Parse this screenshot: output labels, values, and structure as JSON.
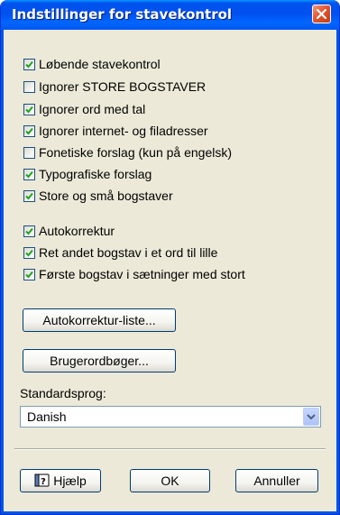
{
  "window": {
    "title": "Indstillinger for stavekontrol"
  },
  "options_group1": [
    {
      "label": "Løbende stavekontrol",
      "checked": true
    },
    {
      "label": "Ignorer STORE BOGSTAVER",
      "checked": false
    },
    {
      "label": "Ignorer ord med tal",
      "checked": true
    },
    {
      "label": "Ignorer internet- og filadresser",
      "checked": true
    },
    {
      "label": "Fonetiske forslag (kun på engelsk)",
      "checked": false
    },
    {
      "label": "Typografiske forslag",
      "checked": true
    },
    {
      "label": "Store og små bogstaver",
      "checked": true
    }
  ],
  "options_group2": [
    {
      "label": "Autokorrektur",
      "checked": true
    },
    {
      "label": "Ret andet bogstav i et ord til lille",
      "checked": true
    },
    {
      "label": "Første bogstav i sætninger med stort",
      "checked": true
    }
  ],
  "buttons": {
    "autocorrect_list": "Autokorrektur-liste...",
    "user_dictionaries": "Brugerordbøger...",
    "help": "Hjælp",
    "ok": "OK",
    "cancel": "Annuller"
  },
  "language": {
    "label": "Standardsprog:",
    "value": "Danish"
  },
  "colors": {
    "titlebar": "#0055ea",
    "dialog_bg": "#ece9d8",
    "checkmark": "#21a121",
    "close_button": "#e5552f"
  },
  "icons": {
    "close": "close-icon",
    "checkmark": "checkmark-icon",
    "dropdown": "chevron-down-icon",
    "help": "help-book-icon"
  }
}
